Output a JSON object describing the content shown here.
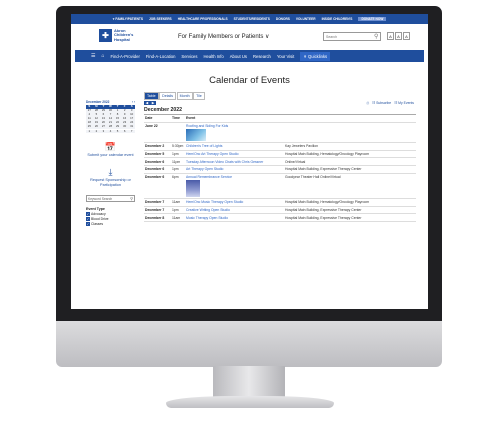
{
  "util_bar": {
    "items": [
      "♥ FAMILY/PATIENTS",
      "JOB SEEKERS",
      "HEALTHCARE PROFESSIONALS",
      "STUDENTS/RESIDENTS",
      "DONORS",
      "VOLUNTEER",
      "INSIDE CHILDREN'S"
    ],
    "donate_label": "DONATE NOW"
  },
  "header": {
    "logo_lines": [
      "Akron",
      "Children's",
      "Hospital"
    ],
    "audience_select": "For Family Members or Patients",
    "search_placeholder": "Search",
    "text_size": [
      "A",
      "A",
      "A"
    ]
  },
  "nav": {
    "items": [
      "Find-A-Provider",
      "Find-A-Location",
      "Services",
      "Health Info",
      "About Us",
      "Research",
      "Your Visit"
    ],
    "quicklinks_label": "Quicklinks"
  },
  "page_title": "Calendar of Events",
  "mini_calendar": {
    "title": "December 2022",
    "days": [
      "S",
      "M",
      "T",
      "W",
      "T",
      "F",
      "S"
    ],
    "dates": [
      "27",
      "28",
      "29",
      "30",
      "1",
      "2",
      "3",
      "4",
      "5",
      "6",
      "7",
      "8",
      "9",
      "10",
      "11",
      "12",
      "13",
      "14",
      "15",
      "16",
      "17",
      "18",
      "19",
      "20",
      "21",
      "22",
      "23",
      "24",
      "25",
      "26",
      "27",
      "28",
      "29",
      "30",
      "31",
      "1",
      "2",
      "3",
      "4",
      "5",
      "6",
      "7"
    ]
  },
  "sidebar": {
    "submit_event": "Submit your calendar event",
    "request_sponsorship": "Request Sponsorship or Participation",
    "keyword_placeholder": "Keyword Search",
    "event_type_title": "Event Type",
    "event_types": [
      "Advocacy",
      "Blood Drive",
      "Classes"
    ]
  },
  "view_tabs": [
    "Table",
    "Details",
    "Month",
    "Tile"
  ],
  "subscribe_label": "Subscribe",
  "my_events_label": "My Events",
  "month_heading": "December 2022",
  "table": {
    "headers": [
      "Date",
      "Time",
      "Event",
      ""
    ],
    "rows": [
      {
        "date": "June 22",
        "time": "",
        "event": "Roofing and Siding For Kids",
        "location": ""
      },
      {
        "date": "December 2",
        "time": "5:30pm",
        "event": "Children's Tree of Lights",
        "location": "Kay Jewelers Pavilion"
      },
      {
        "date": "December 5",
        "time": "1pm",
        "event": "Hem/Onc Art Therapy Open Studio",
        "location": "Hospital Main Building, Hematology/Oncology Playroom"
      },
      {
        "date": "December 6",
        "time": "11pm",
        "event": "Tuesday Afternoon Video Chats with Chris Gessner",
        "location": "Online/Virtual"
      },
      {
        "date": "December 6",
        "time": "1pm",
        "event": "Art Therapy Open Studio",
        "location": "Hospital Main Building, Expressive Therapy Center"
      },
      {
        "date": "December 6",
        "time": "6pm",
        "event": "Annual Remembrance Service",
        "location": "Goodyear Theater Hall Online/Virtual"
      },
      {
        "date": "December 7",
        "time": "11am",
        "event": "Hem/Onc Music Therapy Open Studio",
        "location": "Hospital Main Building, Hematology/Oncology Playroom"
      },
      {
        "date": "December 7",
        "time": "1pm",
        "event": "Creative Writing Open Studio",
        "location": "Hospital Main Building, Expressive Therapy Center"
      },
      {
        "date": "December 8",
        "time": "11am",
        "event": "Music Therapy Open Studio",
        "location": "Hospital Main Building, Expressive Therapy Center"
      }
    ]
  }
}
